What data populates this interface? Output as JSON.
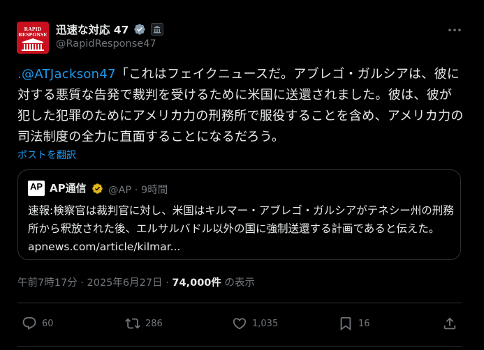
{
  "tweet": {
    "author_name": "迅速な対応 47",
    "author_handle": "@RapidResponse47",
    "avatar_text_line1": "RAPID",
    "avatar_text_line2": "RESPONSE",
    "mention": ".@ATJackson47",
    "body": "「これはフェイクニュースだ。アブレゴ・ガルシアは、彼に対する悪質な告発で裁判を受けるために米国に送還されました。彼は、彼が犯した犯罪のためにアメリカ力の刑務所で服役することを含め、アメリカ力の司法制度の全力に直面することになるだろう。",
    "translate_label": "ポストを翻訳",
    "timestamp": "午前7時17分 · 2025年6月27日 · ",
    "views_count": "74,000件",
    "views_label": " の表示"
  },
  "quote": {
    "logo_text": "AP",
    "name": "AP通信",
    "handle_time": "@AP · 9時間",
    "text": "速報:検察官は裁判官に対し、米国はキルマー・アブレゴ・ガルシアがテネシー州の刑務所から釈放された後、エルサルバドル以外の国に強制送還する計画であると伝えた。apnews.com/article/kilmar..."
  },
  "actions": {
    "reply_count": "60",
    "retweet_count": "286",
    "like_count": "1,035",
    "bookmark_count": "16"
  },
  "colors": {
    "background": "#000000",
    "text": "#e7e9ea",
    "muted": "#71767b",
    "link": "#1d9bf0",
    "verified_gray": "#829aab",
    "verified_gold": "#e2b719",
    "border": "#2f3336"
  }
}
